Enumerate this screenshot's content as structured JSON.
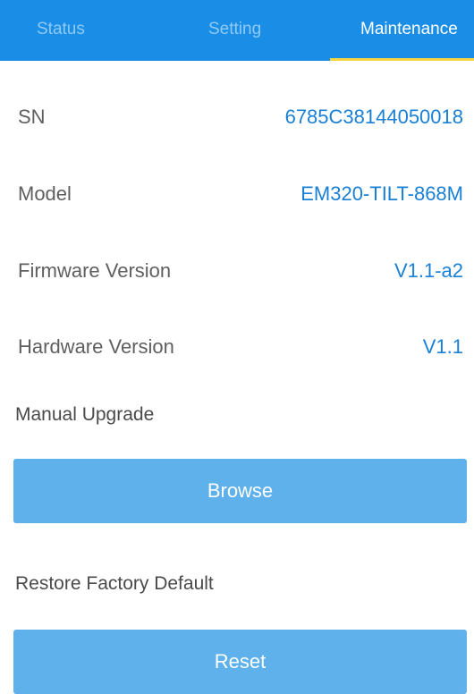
{
  "tabs": [
    {
      "label": "Status",
      "active": false
    },
    {
      "label": "Setting",
      "active": false
    },
    {
      "label": "Maintenance",
      "active": true
    }
  ],
  "info": {
    "sn": {
      "label": "SN",
      "value": "6785C38144050018"
    },
    "model": {
      "label": "Model",
      "value": "EM320-TILT-868M"
    },
    "firmware": {
      "label": "Firmware Version",
      "value": "V1.1-a2"
    },
    "hardware": {
      "label": "Hardware Version",
      "value": "V1.1"
    }
  },
  "upgrade": {
    "label": "Manual Upgrade",
    "button_label": "Browse"
  },
  "restore": {
    "label": "Restore Factory Default",
    "button_label": "Reset"
  },
  "colors": {
    "tabbar": "#1a8ee6",
    "tab_underline": "#f6d542",
    "value_text": "#1a80d6",
    "button": "#5fb1ec"
  }
}
